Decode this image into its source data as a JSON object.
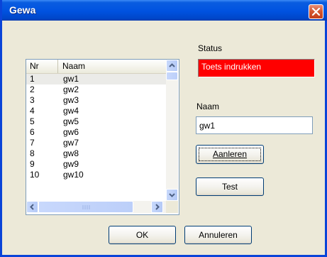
{
  "window": {
    "title": "Gewa"
  },
  "status": {
    "label": "Status",
    "value": "Toets indrukken",
    "color": "#ff0000"
  },
  "name_field": {
    "label": "Naam",
    "value": "gw1"
  },
  "buttons": {
    "learn": "Aanleren",
    "test": "Test",
    "ok": "OK",
    "cancel": "Annuleren"
  },
  "list": {
    "columns": [
      "Nr",
      "Naam"
    ],
    "rows": [
      {
        "nr": "1",
        "name": "gw1"
      },
      {
        "nr": "2",
        "name": "gw2"
      },
      {
        "nr": "3",
        "name": "gw3"
      },
      {
        "nr": "4",
        "name": "gw4"
      },
      {
        "nr": "5",
        "name": "gw5"
      },
      {
        "nr": "6",
        "name": "gw6"
      },
      {
        "nr": "7",
        "name": "gw7"
      },
      {
        "nr": "8",
        "name": "gw8"
      },
      {
        "nr": "9",
        "name": "gw9"
      },
      {
        "nr": "10",
        "name": "gw10"
      }
    ]
  },
  "icons": {
    "close": "close-icon",
    "scroll_up": "arrow-up-icon",
    "scroll_down": "arrow-down-icon",
    "scroll_left": "arrow-left-icon",
    "scroll_right": "arrow-right-icon"
  }
}
